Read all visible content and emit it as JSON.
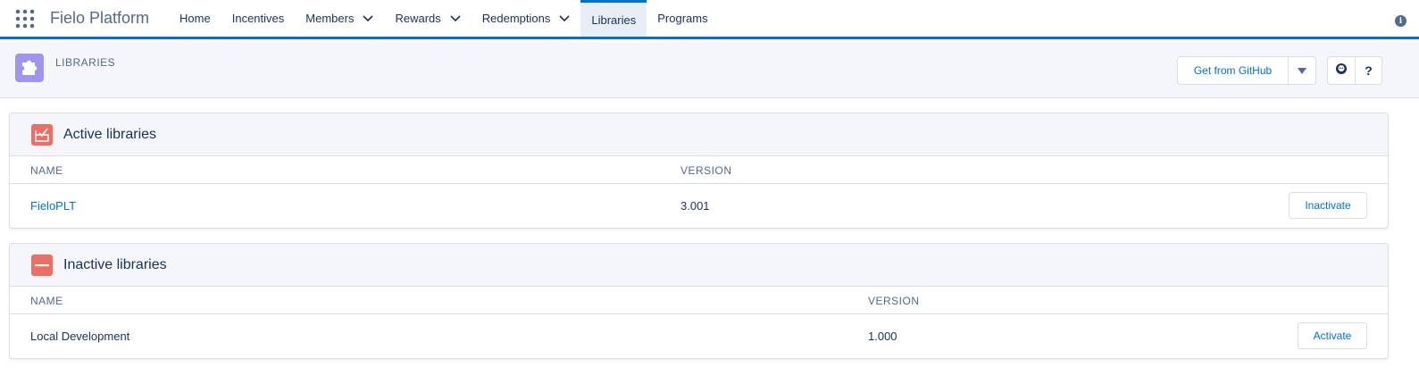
{
  "app": {
    "name": "Fielo Platform"
  },
  "nav": {
    "items": [
      {
        "label": "Home"
      },
      {
        "label": "Incentives"
      },
      {
        "label": "Members"
      },
      {
        "label": "Rewards"
      },
      {
        "label": "Redemptions"
      },
      {
        "label": "Libraries"
      },
      {
        "label": "Programs"
      }
    ]
  },
  "page": {
    "title": "LIBRARIES",
    "get_from_github": "Get from GitHub",
    "help": "?"
  },
  "active_card": {
    "title": "Active libraries",
    "col_name": "NAME",
    "col_version": "VERSION",
    "rows": [
      {
        "name": "FieloPLT",
        "version": "3.001",
        "action": "Inactivate"
      }
    ]
  },
  "inactive_card": {
    "title": "Inactive libraries",
    "col_name": "NAME",
    "col_version": "VERSION",
    "rows": [
      {
        "name": "Local Development",
        "version": "1.000",
        "action": "Activate"
      }
    ]
  },
  "colors": {
    "accent": "#0070d2",
    "page_icon": "#a094ed",
    "card_icon": "#ef6e64"
  }
}
